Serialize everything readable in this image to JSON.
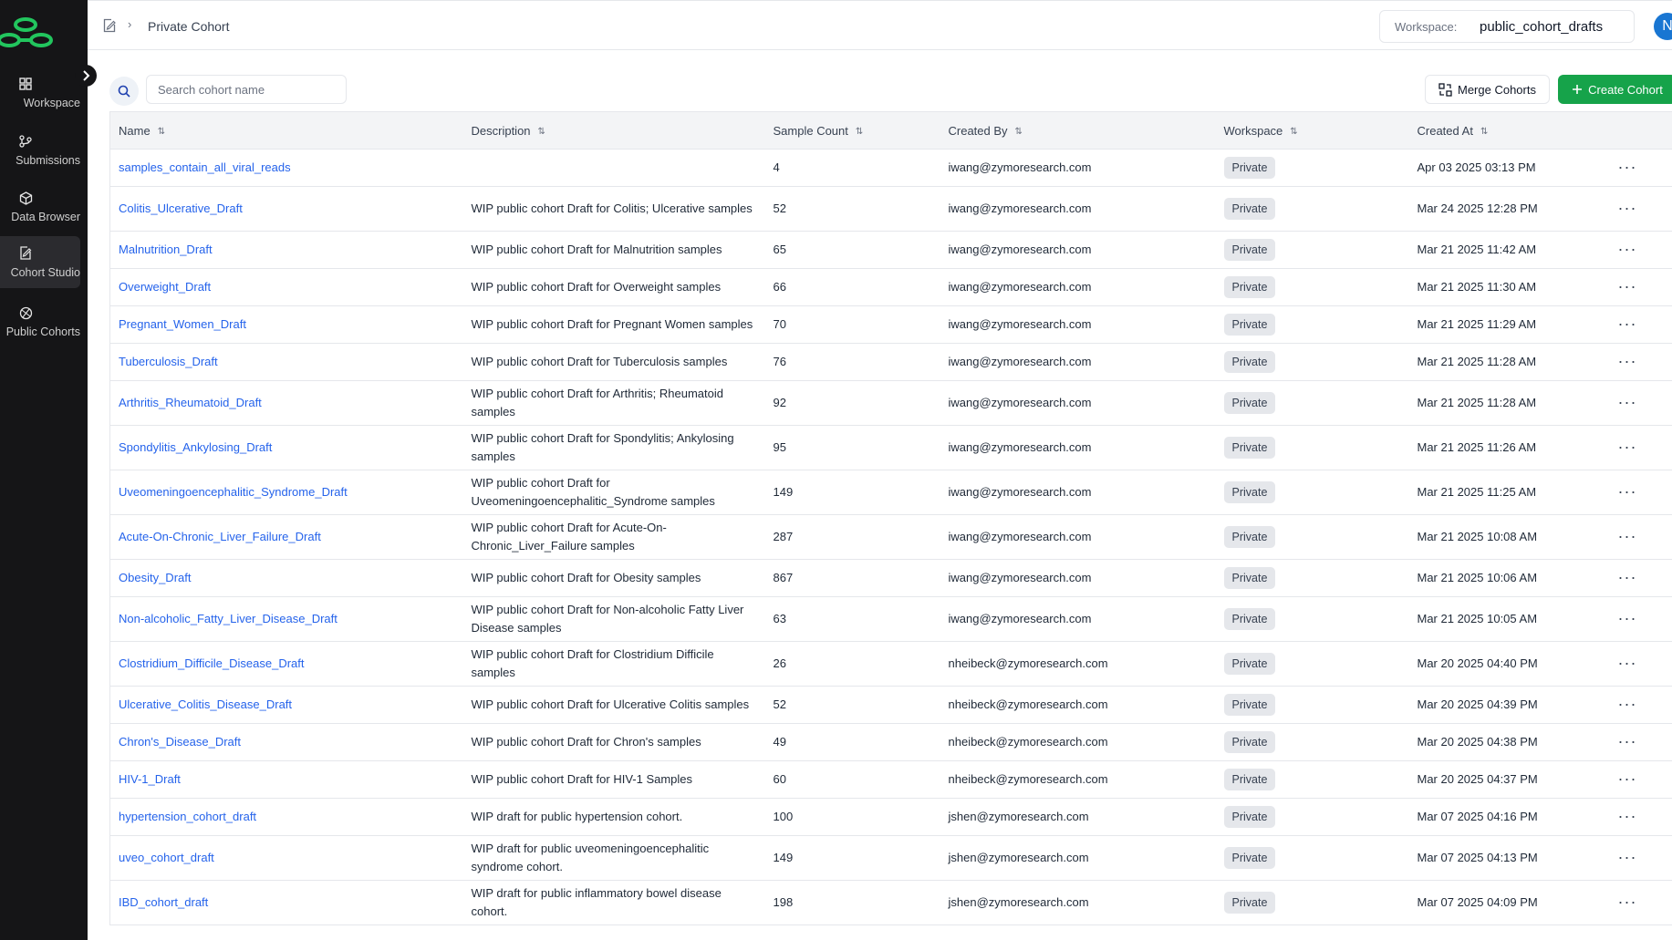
{
  "sidebar": {
    "items": [
      {
        "label": "Workspace",
        "icon": "grid-icon"
      },
      {
        "label": "Submissions",
        "icon": "git-branch-icon"
      },
      {
        "label": "Data Browser",
        "icon": "cube-icon"
      },
      {
        "label": "Cohort Studio",
        "icon": "edit-note-icon"
      },
      {
        "label": "Public Cohorts",
        "icon": "globe-icon"
      }
    ],
    "active_index": 3
  },
  "header": {
    "breadcrumb_title": "Private Cohort",
    "workspace_label": "Workspace:",
    "workspace_value": "public_cohort_drafts",
    "avatar_initial": "N"
  },
  "toolbar": {
    "search_placeholder": "Search cohort name",
    "merge_label": "Merge Cohorts",
    "create_label": "Create Cohort"
  },
  "table": {
    "columns": [
      "Name",
      "Description",
      "Sample Count",
      "Created By",
      "Workspace",
      "Created At"
    ],
    "rows": [
      {
        "name": "samples_contain_all_viral_reads",
        "description": "",
        "count": "4",
        "created_by": "iwang@zymoresearch.com",
        "workspace": "Private",
        "created_at": "Apr 03 2025 03:13 PM"
      },
      {
        "name": "Colitis_Ulcerative_Draft",
        "description": "WIP public cohort Draft for Colitis; Ulcerative samples",
        "count": "52",
        "created_by": "iwang@zymoresearch.com",
        "workspace": "Private",
        "created_at": "Mar 24 2025 12:28 PM"
      },
      {
        "name": "Malnutrition_Draft",
        "description": "WIP public cohort Draft for Malnutrition samples",
        "count": "65",
        "created_by": "iwang@zymoresearch.com",
        "workspace": "Private",
        "created_at": "Mar 21 2025 11:42 AM"
      },
      {
        "name": "Overweight_Draft",
        "description": "WIP public cohort Draft for Overweight samples",
        "count": "66",
        "created_by": "iwang@zymoresearch.com",
        "workspace": "Private",
        "created_at": "Mar 21 2025 11:30 AM"
      },
      {
        "name": "Pregnant_Women_Draft",
        "description": "WIP public cohort Draft for Pregnant Women samples",
        "count": "70",
        "created_by": "iwang@zymoresearch.com",
        "workspace": "Private",
        "created_at": "Mar 21 2025 11:29 AM"
      },
      {
        "name": "Tuberculosis_Draft",
        "description": "WIP public cohort Draft for Tuberculosis samples",
        "count": "76",
        "created_by": "iwang@zymoresearch.com",
        "workspace": "Private",
        "created_at": "Mar 21 2025 11:28 AM"
      },
      {
        "name": "Arthritis_Rheumatoid_Draft",
        "description": "WIP public cohort Draft for Arthritis; Rheumatoid samples",
        "count": "92",
        "created_by": "iwang@zymoresearch.com",
        "workspace": "Private",
        "created_at": "Mar 21 2025 11:28 AM"
      },
      {
        "name": "Spondylitis_Ankylosing_Draft",
        "description": "WIP public cohort Draft for Spondylitis; Ankylosing samples",
        "count": "95",
        "created_by": "iwang@zymoresearch.com",
        "workspace": "Private",
        "created_at": "Mar 21 2025 11:26 AM"
      },
      {
        "name": "Uveomeningoencephalitic_Syndrome_Draft",
        "description": "WIP public cohort Draft for Uveomeningoencephalitic_Syndrome samples",
        "count": "149",
        "created_by": "iwang@zymoresearch.com",
        "workspace": "Private",
        "created_at": "Mar 21 2025 11:25 AM"
      },
      {
        "name": "Acute-On-Chronic_Liver_Failure_Draft",
        "description": "WIP public cohort Draft for Acute-On-Chronic_Liver_Failure samples",
        "count": "287",
        "created_by": "iwang@zymoresearch.com",
        "workspace": "Private",
        "created_at": "Mar 21 2025 10:08 AM"
      },
      {
        "name": "Obesity_Draft",
        "description": "WIP public cohort Draft for Obesity samples",
        "count": "867",
        "created_by": "iwang@zymoresearch.com",
        "workspace": "Private",
        "created_at": "Mar 21 2025 10:06 AM"
      },
      {
        "name": "Non-alcoholic_Fatty_Liver_Disease_Draft",
        "description": "WIP public cohort Draft for Non-alcoholic Fatty Liver Disease samples",
        "count": "63",
        "created_by": "iwang@zymoresearch.com",
        "workspace": "Private",
        "created_at": "Mar 21 2025 10:05 AM"
      },
      {
        "name": "Clostridium_Difficile_Disease_Draft",
        "description": "WIP public cohort Draft for Clostridium Difficile samples",
        "count": "26",
        "created_by": "nheibeck@zymoresearch.com",
        "workspace": "Private",
        "created_at": "Mar 20 2025 04:40 PM"
      },
      {
        "name": "Ulcerative_Colitis_Disease_Draft",
        "description": "WIP public cohort Draft for Ulcerative Colitis samples",
        "count": "52",
        "created_by": "nheibeck@zymoresearch.com",
        "workspace": "Private",
        "created_at": "Mar 20 2025 04:39 PM"
      },
      {
        "name": "Chron's_Disease_Draft",
        "description": "WIP public cohort Draft for Chron's samples",
        "count": "49",
        "created_by": "nheibeck@zymoresearch.com",
        "workspace": "Private",
        "created_at": "Mar 20 2025 04:38 PM"
      },
      {
        "name": "HIV-1_Draft",
        "description": "WIP public cohort Draft for HIV-1 Samples",
        "count": "60",
        "created_by": "nheibeck@zymoresearch.com",
        "workspace": "Private",
        "created_at": "Mar 20 2025 04:37 PM"
      },
      {
        "name": "hypertension_cohort_draft",
        "description": "WIP draft for public hypertension cohort.",
        "count": "100",
        "created_by": "jshen@zymoresearch.com",
        "workspace": "Private",
        "created_at": "Mar 07 2025 04:16 PM"
      },
      {
        "name": "uveo_cohort_draft",
        "description": "WIP draft for public uveomeningoencephalitic syndrome cohort.",
        "count": "149",
        "created_by": "jshen@zymoresearch.com",
        "workspace": "Private",
        "created_at": "Mar 07 2025 04:13 PM"
      },
      {
        "name": "IBD_cohort_draft",
        "description": "WIP draft for public inflammatory bowel disease cohort.",
        "count": "198",
        "created_by": "jshen@zymoresearch.com",
        "workspace": "Private",
        "created_at": "Mar 07 2025 04:09 PM"
      }
    ],
    "double_rows": [
      1,
      6,
      7,
      8,
      9,
      11,
      12,
      17,
      18
    ]
  },
  "colors": {
    "sidebar_bg": "#151517",
    "link": "#2563eb",
    "primary_button": "#16a34a",
    "logo": "#22c55e",
    "avatar": "#1976d2"
  }
}
